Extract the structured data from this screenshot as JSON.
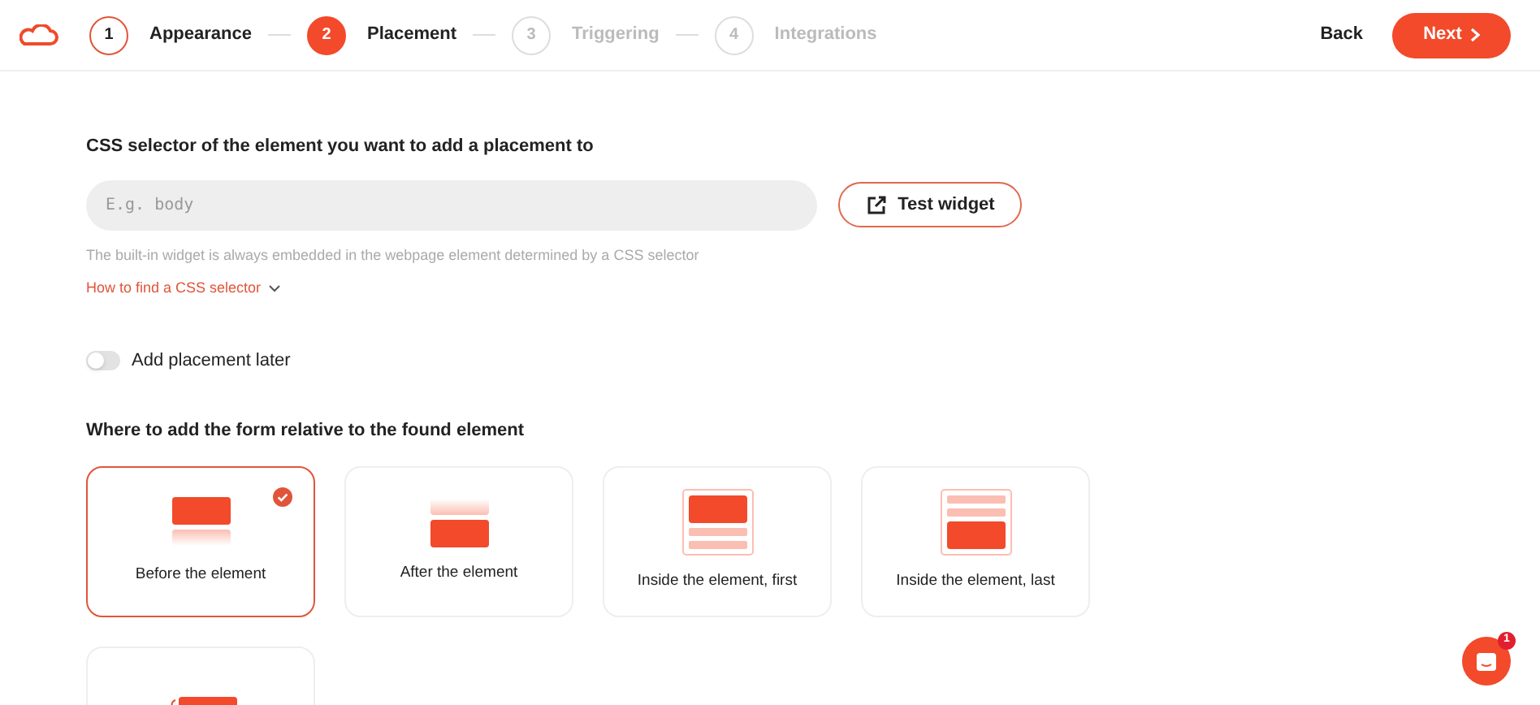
{
  "steps": [
    {
      "number": "1",
      "label": "Appearance",
      "completed": true,
      "selected": false
    },
    {
      "number": "2",
      "label": "Placement",
      "completed": false,
      "selected": true
    },
    {
      "number": "3",
      "label": "Triggering",
      "completed": false,
      "selected": false
    },
    {
      "number": "4",
      "label": "Integrations",
      "completed": false,
      "selected": false
    }
  ],
  "nav": {
    "back": "Back",
    "next": "Next"
  },
  "selector": {
    "label": "CSS selector of the element you want to add a placement to",
    "placeholder": "E.g. body",
    "test_button": "Test widget",
    "hint": "The built-in widget is always embedded in the webpage element determined by a CSS selector",
    "help_link": "How to find a CSS selector"
  },
  "toggle": {
    "label": "Add placement later",
    "on": false
  },
  "position": {
    "label": "Where to add the form relative to the found element",
    "options": [
      {
        "kind": "before",
        "label": "Before the element",
        "selected": true
      },
      {
        "kind": "after",
        "label": "After the element",
        "selected": false
      },
      {
        "kind": "inside_first",
        "label": "Inside the element, first",
        "selected": false
      },
      {
        "kind": "inside_last",
        "label": "Inside the element, last",
        "selected": false
      },
      {
        "kind": "other",
        "selected": false
      }
    ]
  },
  "chat": {
    "badge": "1"
  }
}
